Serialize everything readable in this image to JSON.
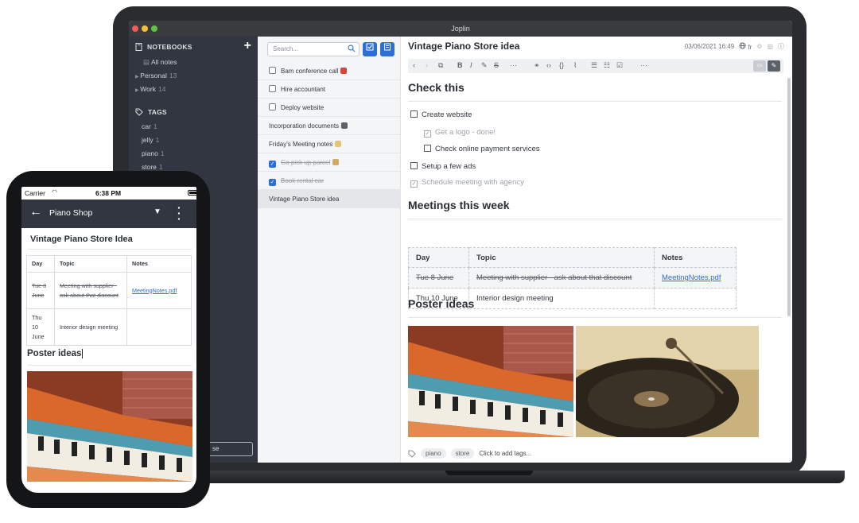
{
  "laptop": {
    "window_title": "Joplin",
    "sidebar": {
      "notebooks_header": "NOTEBOOKS",
      "add_label": "+",
      "all_notes": "All notes",
      "notebooks": [
        {
          "label": "Personal",
          "count": "13"
        },
        {
          "label": "Work",
          "count": "14"
        }
      ],
      "tags_header": "TAGS",
      "tags": [
        {
          "label": "car",
          "count": "1"
        },
        {
          "label": "jelly",
          "count": "1"
        },
        {
          "label": "piano",
          "count": "1"
        },
        {
          "label": "store",
          "count": "1"
        }
      ],
      "sync_button": "se"
    },
    "note_list": {
      "search_placeholder": "Search...",
      "notes": [
        {
          "title": "Bam conference call",
          "type": "todo",
          "done": false
        },
        {
          "title": "Hire accountant",
          "type": "todo",
          "done": false
        },
        {
          "title": "Deploy website",
          "type": "todo",
          "done": false
        },
        {
          "title": "Incorporation documents",
          "type": "note",
          "done": false
        },
        {
          "title": "Friday's Meeting notes",
          "type": "note",
          "done": false
        },
        {
          "title": "Go pick up parcel",
          "type": "todo",
          "done": true
        },
        {
          "title": "Book rental car",
          "type": "todo",
          "done": true
        },
        {
          "title": "Vintage Piano Store idea",
          "type": "note",
          "done": false,
          "selected": true
        }
      ]
    },
    "editor": {
      "title": "Vintage Piano Store idea",
      "timestamp": "03/06/2021 16:49",
      "language": "fr",
      "heading_check": "Check this",
      "tasks": [
        {
          "label": "Create website",
          "done": false
        },
        {
          "label": "Get a logo - done!",
          "done": true
        },
        {
          "label": "Check online payment services",
          "done": false
        },
        {
          "label": "Setup a few ads",
          "done": false
        },
        {
          "label": "Schedule meeting with agency",
          "done": true
        }
      ],
      "heading_meetings": "Meetings this week",
      "table": {
        "headers": [
          "Day",
          "Topic",
          "Notes"
        ],
        "rows": [
          {
            "day": "Tue 8 June",
            "topic": "Meeting with supplier - ask about that discount",
            "notes": "MeetingNotes.pdf"
          },
          {
            "day": "Thu 10 June",
            "topic": "Interior design meeting",
            "notes": ""
          }
        ]
      },
      "heading_poster": "Poster ideas",
      "tags": [
        "piano",
        "store"
      ],
      "add_tags": "Click to add tags..."
    }
  },
  "phone": {
    "carrier": "Carrier",
    "time": "6:38 PM",
    "notebook_title": "Piano Shop",
    "note_title": "Vintage Piano Store Idea",
    "table": {
      "headers": [
        "Day",
        "Topic",
        "Notes"
      ],
      "rows": [
        {
          "day": "Tue 8 June",
          "topic": "Meeting with supplier - ask about that discount",
          "notes": "MeetingNotes.pdf"
        },
        {
          "day": "Thu 10 June",
          "topic": "Interior design meeting",
          "notes": ""
        }
      ]
    },
    "heading_poster": "Poster ideas"
  },
  "colors": {
    "accent": "#2d6fd2",
    "sidebar_bg": "#313640"
  }
}
